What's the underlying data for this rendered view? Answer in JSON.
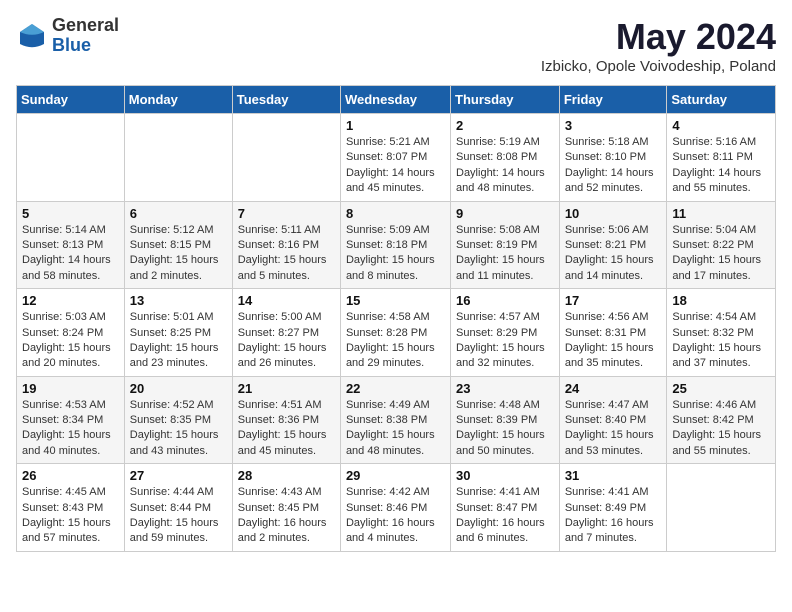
{
  "logo": {
    "general": "General",
    "blue": "Blue"
  },
  "title": "May 2024",
  "location": "Izbicko, Opole Voivodeship, Poland",
  "days_of_week": [
    "Sunday",
    "Monday",
    "Tuesday",
    "Wednesday",
    "Thursday",
    "Friday",
    "Saturday"
  ],
  "weeks": [
    [
      {
        "day": "",
        "info": ""
      },
      {
        "day": "",
        "info": ""
      },
      {
        "day": "",
        "info": ""
      },
      {
        "day": "1",
        "info": "Sunrise: 5:21 AM\nSunset: 8:07 PM\nDaylight: 14 hours and 45 minutes."
      },
      {
        "day": "2",
        "info": "Sunrise: 5:19 AM\nSunset: 8:08 PM\nDaylight: 14 hours and 48 minutes."
      },
      {
        "day": "3",
        "info": "Sunrise: 5:18 AM\nSunset: 8:10 PM\nDaylight: 14 hours and 52 minutes."
      },
      {
        "day": "4",
        "info": "Sunrise: 5:16 AM\nSunset: 8:11 PM\nDaylight: 14 hours and 55 minutes."
      }
    ],
    [
      {
        "day": "5",
        "info": "Sunrise: 5:14 AM\nSunset: 8:13 PM\nDaylight: 14 hours and 58 minutes."
      },
      {
        "day": "6",
        "info": "Sunrise: 5:12 AM\nSunset: 8:15 PM\nDaylight: 15 hours and 2 minutes."
      },
      {
        "day": "7",
        "info": "Sunrise: 5:11 AM\nSunset: 8:16 PM\nDaylight: 15 hours and 5 minutes."
      },
      {
        "day": "8",
        "info": "Sunrise: 5:09 AM\nSunset: 8:18 PM\nDaylight: 15 hours and 8 minutes."
      },
      {
        "day": "9",
        "info": "Sunrise: 5:08 AM\nSunset: 8:19 PM\nDaylight: 15 hours and 11 minutes."
      },
      {
        "day": "10",
        "info": "Sunrise: 5:06 AM\nSunset: 8:21 PM\nDaylight: 15 hours and 14 minutes."
      },
      {
        "day": "11",
        "info": "Sunrise: 5:04 AM\nSunset: 8:22 PM\nDaylight: 15 hours and 17 minutes."
      }
    ],
    [
      {
        "day": "12",
        "info": "Sunrise: 5:03 AM\nSunset: 8:24 PM\nDaylight: 15 hours and 20 minutes."
      },
      {
        "day": "13",
        "info": "Sunrise: 5:01 AM\nSunset: 8:25 PM\nDaylight: 15 hours and 23 minutes."
      },
      {
        "day": "14",
        "info": "Sunrise: 5:00 AM\nSunset: 8:27 PM\nDaylight: 15 hours and 26 minutes."
      },
      {
        "day": "15",
        "info": "Sunrise: 4:58 AM\nSunset: 8:28 PM\nDaylight: 15 hours and 29 minutes."
      },
      {
        "day": "16",
        "info": "Sunrise: 4:57 AM\nSunset: 8:29 PM\nDaylight: 15 hours and 32 minutes."
      },
      {
        "day": "17",
        "info": "Sunrise: 4:56 AM\nSunset: 8:31 PM\nDaylight: 15 hours and 35 minutes."
      },
      {
        "day": "18",
        "info": "Sunrise: 4:54 AM\nSunset: 8:32 PM\nDaylight: 15 hours and 37 minutes."
      }
    ],
    [
      {
        "day": "19",
        "info": "Sunrise: 4:53 AM\nSunset: 8:34 PM\nDaylight: 15 hours and 40 minutes."
      },
      {
        "day": "20",
        "info": "Sunrise: 4:52 AM\nSunset: 8:35 PM\nDaylight: 15 hours and 43 minutes."
      },
      {
        "day": "21",
        "info": "Sunrise: 4:51 AM\nSunset: 8:36 PM\nDaylight: 15 hours and 45 minutes."
      },
      {
        "day": "22",
        "info": "Sunrise: 4:49 AM\nSunset: 8:38 PM\nDaylight: 15 hours and 48 minutes."
      },
      {
        "day": "23",
        "info": "Sunrise: 4:48 AM\nSunset: 8:39 PM\nDaylight: 15 hours and 50 minutes."
      },
      {
        "day": "24",
        "info": "Sunrise: 4:47 AM\nSunset: 8:40 PM\nDaylight: 15 hours and 53 minutes."
      },
      {
        "day": "25",
        "info": "Sunrise: 4:46 AM\nSunset: 8:42 PM\nDaylight: 15 hours and 55 minutes."
      }
    ],
    [
      {
        "day": "26",
        "info": "Sunrise: 4:45 AM\nSunset: 8:43 PM\nDaylight: 15 hours and 57 minutes."
      },
      {
        "day": "27",
        "info": "Sunrise: 4:44 AM\nSunset: 8:44 PM\nDaylight: 15 hours and 59 minutes."
      },
      {
        "day": "28",
        "info": "Sunrise: 4:43 AM\nSunset: 8:45 PM\nDaylight: 16 hours and 2 minutes."
      },
      {
        "day": "29",
        "info": "Sunrise: 4:42 AM\nSunset: 8:46 PM\nDaylight: 16 hours and 4 minutes."
      },
      {
        "day": "30",
        "info": "Sunrise: 4:41 AM\nSunset: 8:47 PM\nDaylight: 16 hours and 6 minutes."
      },
      {
        "day": "31",
        "info": "Sunrise: 4:41 AM\nSunset: 8:49 PM\nDaylight: 16 hours and 7 minutes."
      },
      {
        "day": "",
        "info": ""
      }
    ]
  ]
}
